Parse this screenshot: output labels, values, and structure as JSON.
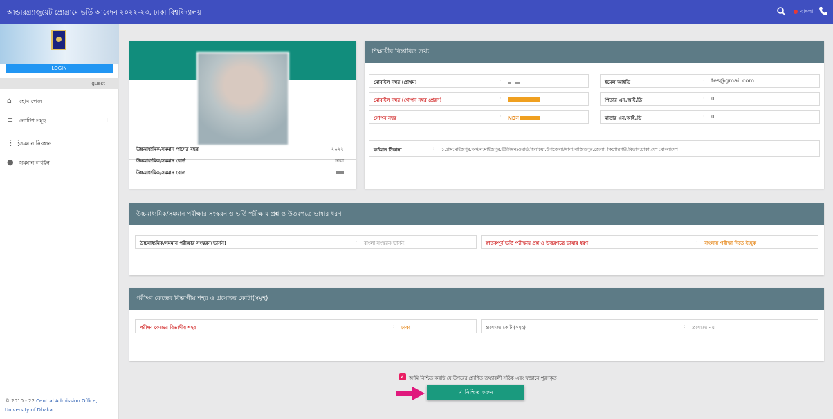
{
  "header": {
    "title": "আন্ডারগ্র্যাজুয়েট প্রোগ্রামে ভর্তি আবেদন ২০২২-২৩, ঢাকা বিশ্ববিদ্যালয়",
    "language_label": "বাংলা",
    "accent_color": "#3f4fc0"
  },
  "sidebar": {
    "login_label": "LOGIN",
    "user_label": "guest",
    "items": [
      {
        "icon": "home-icon",
        "label": "হোম পেজ"
      },
      {
        "icon": "list-icon",
        "label": "নোটিশ সমূহ",
        "expand": "+"
      },
      {
        "icon": "grid-icon",
        "label": "সমমান নিবন্ধন"
      },
      {
        "icon": "user-icon",
        "label": "সমমান লগইন"
      }
    ],
    "footer_line1_prefix": "© 2010 - 22",
    "footer_line1_link": "Central Admission Office,",
    "footer_line2": "University of Dhaka"
  },
  "profile": {
    "rows": [
      {
        "label": "উচ্চমাধ্যমিক/সমমান পাসের বছর",
        "value": "২০২২"
      },
      {
        "label": "উচ্চমাধ্যমিক/সমমান বোর্ড",
        "value": "ঢাকা"
      },
      {
        "label": "উচ্চমাধ্যমিক/সমমান রোল",
        "value": ""
      }
    ]
  },
  "student_info": {
    "heading": "শিক্ষার্থীর বিস্তারিত তথ্য",
    "mobile_primary_label": "মোবাইল নম্বর (প্রাথম)",
    "mobile_secret_label": "মোবাইল নম্বর (গোপন নম্বর প্রেরণ)",
    "secret_number_label": "গোপন নম্বর",
    "secret_number_prefix": "NDন",
    "email_label": "ইমেল আইডি",
    "email_value": "tes@gmail.com",
    "father_nid_label": "পিতার এন.আই.ডি",
    "father_nid_value": "0",
    "mother_nid_label": "মাতার এন.আই.ডি",
    "mother_nid_value": "0",
    "address_label": "বর্তমান ঠিকানা",
    "address_value": "১,গ্রাম:মাইজপুর,অঞ্চল:মাইজপুর,ইউনিয়ন/ওয়ার্ড:হিলচিয়া,উপজেলা/থানা:বাজিতপুর,জেলা: কিশোরগঞ্জ,বিভাগ:ঢাকা,দেশ :বাংলাদেশ"
  },
  "language_section": {
    "heading": "উচ্চমাধ্যমিক/সমমান পরীক্ষার সংস্করন ও ভর্তি পরীক্ষায় প্রশ্ন ও উত্তরপত্রে ভাষার ধরণ",
    "version_label": "উচ্চমাধ্যমিক/সমমান পরীক্ষার সংস্করন(ভার্সন)",
    "version_value": "বাংলা সংস্করন(ভার্সন)",
    "exam_lang_label": "স্নাতকপূর্ব ভর্তি পরীক্ষায় প্রশ্ন ও উত্তরপত্রে ভাষার ধরণ",
    "exam_lang_value": "বাংলায় পরীক্ষা দিতে ইচ্ছুক"
  },
  "center_section": {
    "heading": "পরীক্ষা কেন্দ্রের বিভাগীয় শহর ও প্রযোজ্য কোটা(সমূহ)",
    "city_label": "পরীক্ষা কেন্দ্রের বিভাগীয় শহর",
    "city_value": "ঢাকা",
    "quota_label": "প্রযোজ্য কোটা(সমূহ)",
    "quota_value": "প্রযোজ্য নয়"
  },
  "confirm": {
    "checkbox_text": "আমি নিশ্চিত করছি যে উপরের প্রদর্শিত তথ্যাবলী সঠিক এবং স্বজ্ঞানে পূরণকৃত",
    "button_label": "✓ নিশ্চিত করুন"
  },
  "colors": {
    "teal": "#118d7c",
    "section_header": "#5d7b86",
    "warning_red": "#d32f2f",
    "highlight_orange": "#e68a1f",
    "arrow": "#e0197d"
  }
}
